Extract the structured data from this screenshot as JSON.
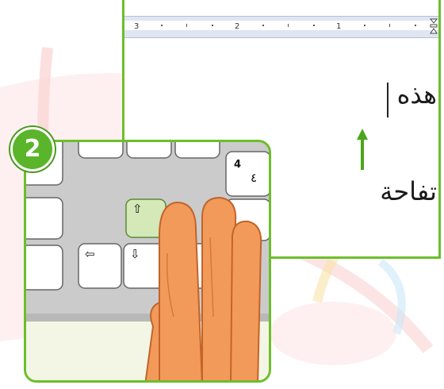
{
  "step": {
    "number": "2"
  },
  "document": {
    "ruler_numbers": [
      "3",
      "2",
      "1"
    ],
    "line1": "هذه",
    "line2": "تفاحة"
  },
  "keyboard": {
    "key_4_en": "4",
    "key_4_ar": "٤",
    "arrow_up": "⇧",
    "arrow_left": "⇦",
    "arrow_down": "⇩"
  },
  "colors": {
    "frame_green": "#6cbf2a",
    "badge_green": "#5ab52a",
    "highlight_key": "#d4e8b8",
    "finger": "#f29a5a",
    "finger_outline": "#c4632a",
    "up_arrow": "#49a61c"
  },
  "icons": {
    "up_arrow": "up-arrow-icon",
    "indent_marker": "indent-marker-icon"
  }
}
